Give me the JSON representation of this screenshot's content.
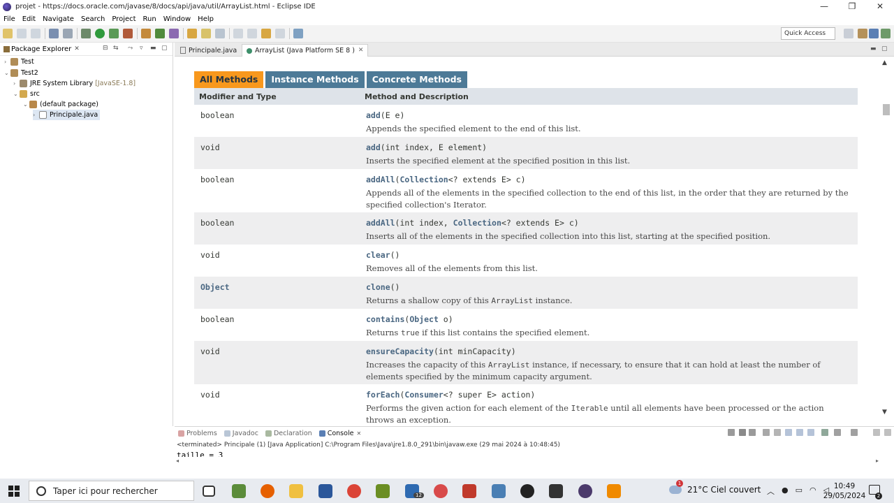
{
  "window": {
    "title": "projet - https://docs.oracle.com/javase/8/docs/api/java/util/ArrayList.html - Eclipse IDE",
    "controls": [
      "—",
      "❐",
      "✕"
    ]
  },
  "menu": [
    "File",
    "Edit",
    "Navigate",
    "Search",
    "Project",
    "Run",
    "Window",
    "Help"
  ],
  "toolbar": {
    "quick_access": "Quick Access"
  },
  "package_explorer": {
    "title": "Package Explorer",
    "tree": [
      {
        "label": "Test",
        "extra": "",
        "twisty": "›"
      },
      {
        "label": "Test2",
        "extra": "",
        "twisty": "⌄"
      },
      {
        "label": "JRE System Library",
        "extra": "[JavaSE-1.8]",
        "twisty": "›"
      },
      {
        "label": "src",
        "extra": "",
        "twisty": "⌄"
      },
      {
        "label": "(default package)",
        "extra": "",
        "twisty": "⌄"
      },
      {
        "label": "Principale.java",
        "extra": "",
        "twisty": "›"
      }
    ]
  },
  "editor": {
    "tabs": [
      {
        "label": "Principale.java"
      },
      {
        "label": "ArrayList (Java Platform SE 8 )"
      }
    ],
    "method_tabs": [
      "All Methods",
      "Instance Methods",
      "Concrete Methods"
    ],
    "table_headers": [
      "Modifier and Type",
      "Method and Description"
    ],
    "rows": [
      {
        "type": "boolean",
        "name": "add",
        "params": "(E e)",
        "desc": "Appends the specified element to the end of this list."
      },
      {
        "type": "void",
        "name": "add",
        "params": "(int index, E element)",
        "desc": "Inserts the specified element at the specified position in this list."
      },
      {
        "type": "boolean",
        "name": "addAll",
        "params_pre": "(",
        "params_type": "Collection",
        "params_post": "<? extends E> c)",
        "desc": "Appends all of the elements in the specified collection to the end of this list, in the order that they are returned by the specified collection's Iterator."
      },
      {
        "type": "boolean",
        "name": "addAll",
        "params_pre": "(int index, ",
        "params_type": "Collection",
        "params_post": "<? extends E> c)",
        "desc": "Inserts all of the elements in the specified collection into this list, starting at the specified position."
      },
      {
        "type": "void",
        "name": "clear",
        "params": "()",
        "desc": "Removes all of the elements from this list."
      },
      {
        "type": "Object",
        "name": "clone",
        "params": "()",
        "desc_pre": "Returns a shallow copy of this ",
        "desc_code": "ArrayList",
        "desc_post": " instance."
      },
      {
        "type": "boolean",
        "name": "contains",
        "params_pre": "(",
        "params_type": "Object",
        "params_post": " o)",
        "desc_pre": "Returns ",
        "desc_code": "true",
        "desc_post": " if this list contains the specified element."
      },
      {
        "type": "void",
        "name": "ensureCapacity",
        "params": "(int minCapacity)",
        "desc_pre": "Increases the capacity of this ",
        "desc_code": "ArrayList",
        "desc_post": " instance, if necessary, to ensure that it can hold at least the number of elements specified by the minimum capacity argument."
      },
      {
        "type": "void",
        "name": "forEach",
        "params_pre": "(",
        "params_type": "Consumer",
        "params_post": "<? super E> action)",
        "desc_pre": "Performs the given action for each element of the ",
        "desc_code": "Iterable",
        "desc_post": " until all elements have been processed or the action throws an exception."
      }
    ]
  },
  "console": {
    "tabs": [
      "Problems",
      "Javadoc",
      "Declaration",
      "Console"
    ],
    "terminated": "<terminated> Principale (1) [Java Application] C:\\Program Files\\Java\\jre1.8.0_291\\bin\\javaw.exe (29 mai 2024 à 10:48:45)",
    "output": "taille = 3"
  },
  "taskbar": {
    "search_placeholder": "Taper ici pour rechercher",
    "mail_badge": "12",
    "weather": "21°C  Ciel couvert",
    "weather_alert": "1",
    "time": "10:49",
    "date": "29/05/2024",
    "notification_count": "2"
  },
  "colors": {
    "active_method_tab": "#f8981d",
    "method_tab": "#4d7a97",
    "header_row": "#dee3e9",
    "alt_row": "#eeeeef",
    "link": "#4a6782"
  }
}
